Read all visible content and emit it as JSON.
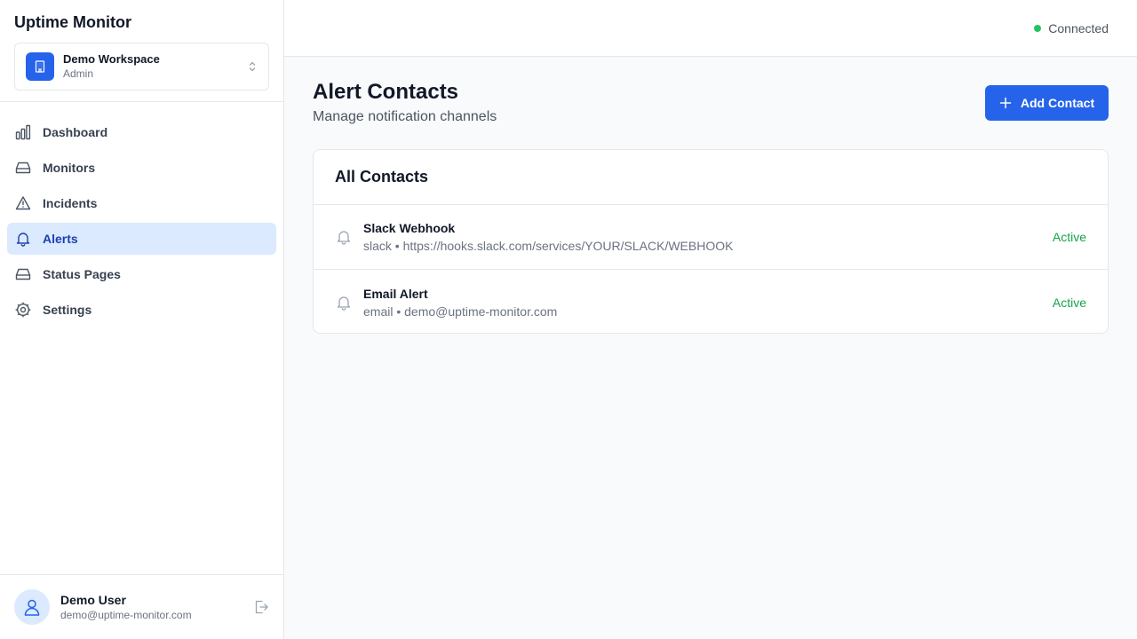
{
  "app": {
    "title": "Uptime Monitor"
  },
  "workspace": {
    "name": "Demo Workspace",
    "role": "Admin"
  },
  "nav": {
    "items": [
      {
        "label": "Dashboard",
        "icon": "bar-chart-icon",
        "active": false
      },
      {
        "label": "Monitors",
        "icon": "hard-drive-icon",
        "active": false
      },
      {
        "label": "Incidents",
        "icon": "alert-triangle-icon",
        "active": false
      },
      {
        "label": "Alerts",
        "icon": "bell-icon",
        "active": true
      },
      {
        "label": "Status Pages",
        "icon": "hard-drive-icon",
        "active": false
      },
      {
        "label": "Settings",
        "icon": "gear-icon",
        "active": false
      }
    ]
  },
  "user": {
    "name": "Demo User",
    "email": "demo@uptime-monitor.com"
  },
  "topbar": {
    "connection_status": "Connected",
    "status_color": "#22c55e"
  },
  "page": {
    "title": "Alert Contacts",
    "subtitle": "Manage notification channels",
    "add_button_label": "Add Contact"
  },
  "contacts": {
    "header": "All Contacts",
    "items": [
      {
        "name": "Slack Webhook",
        "detail": "slack • https://hooks.slack.com/services/YOUR/SLACK/WEBHOOK",
        "status": "Active"
      },
      {
        "name": "Email Alert",
        "detail": "email • demo@uptime-monitor.com",
        "status": "Active"
      }
    ]
  },
  "colors": {
    "accent": "#2563eb",
    "active_nav_bg": "#dbeafe",
    "status_active": "#16a34a"
  }
}
